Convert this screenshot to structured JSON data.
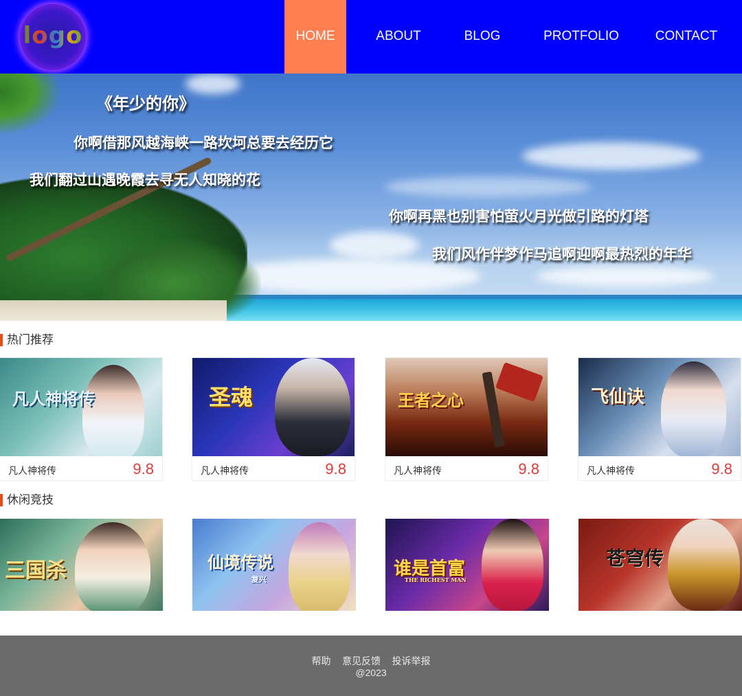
{
  "header": {
    "logo_text": "logo",
    "nav": [
      {
        "label": "HOME",
        "active": true
      },
      {
        "label": "ABOUT"
      },
      {
        "label": "BLOG"
      },
      {
        "label": "PROTFOLIO"
      },
      {
        "label": "CONTACT"
      }
    ]
  },
  "banner": {
    "lines": [
      "《年少的你》",
      "你啊借那风越海峡一路坎坷总要去经历它",
      "我们翻过山遇晚霞去寻无人知晓的花",
      "你啊再黑也别害怕萤火月光做引路的灯塔",
      "我们风作伴梦作马追啊迎啊最热烈的年华"
    ]
  },
  "hot": {
    "title": "热门推荐",
    "cards": [
      {
        "logo": "凡人神将传",
        "name": "凡人神将传",
        "score": "9.8"
      },
      {
        "logo": "圣魂",
        "name": "凡人神将传",
        "score": "9.8"
      },
      {
        "logo": "王者之心",
        "name": "凡人神将传",
        "score": "9.8"
      },
      {
        "logo": "飞仙诀",
        "name": "凡人神将传",
        "score": "9.8"
      }
    ]
  },
  "casual": {
    "title": "休闲竞技",
    "tiles": [
      {
        "logo": "三国杀"
      },
      {
        "logo": "仙境传说",
        "sub": "复兴"
      },
      {
        "logo": "谁是首富",
        "sub": "THE RICHEST MAN"
      },
      {
        "logo": "苍穹传"
      }
    ]
  },
  "footer": {
    "links": [
      "帮助",
      "意见反馈",
      "投诉举报"
    ],
    "copyright": "@2023"
  },
  "colors": {
    "header_bg": "#0000ff",
    "nav_active": "#ff7f50",
    "score": "#e53935",
    "section_bar": "#e64a19",
    "footer_bg": "#6b6b6b"
  }
}
